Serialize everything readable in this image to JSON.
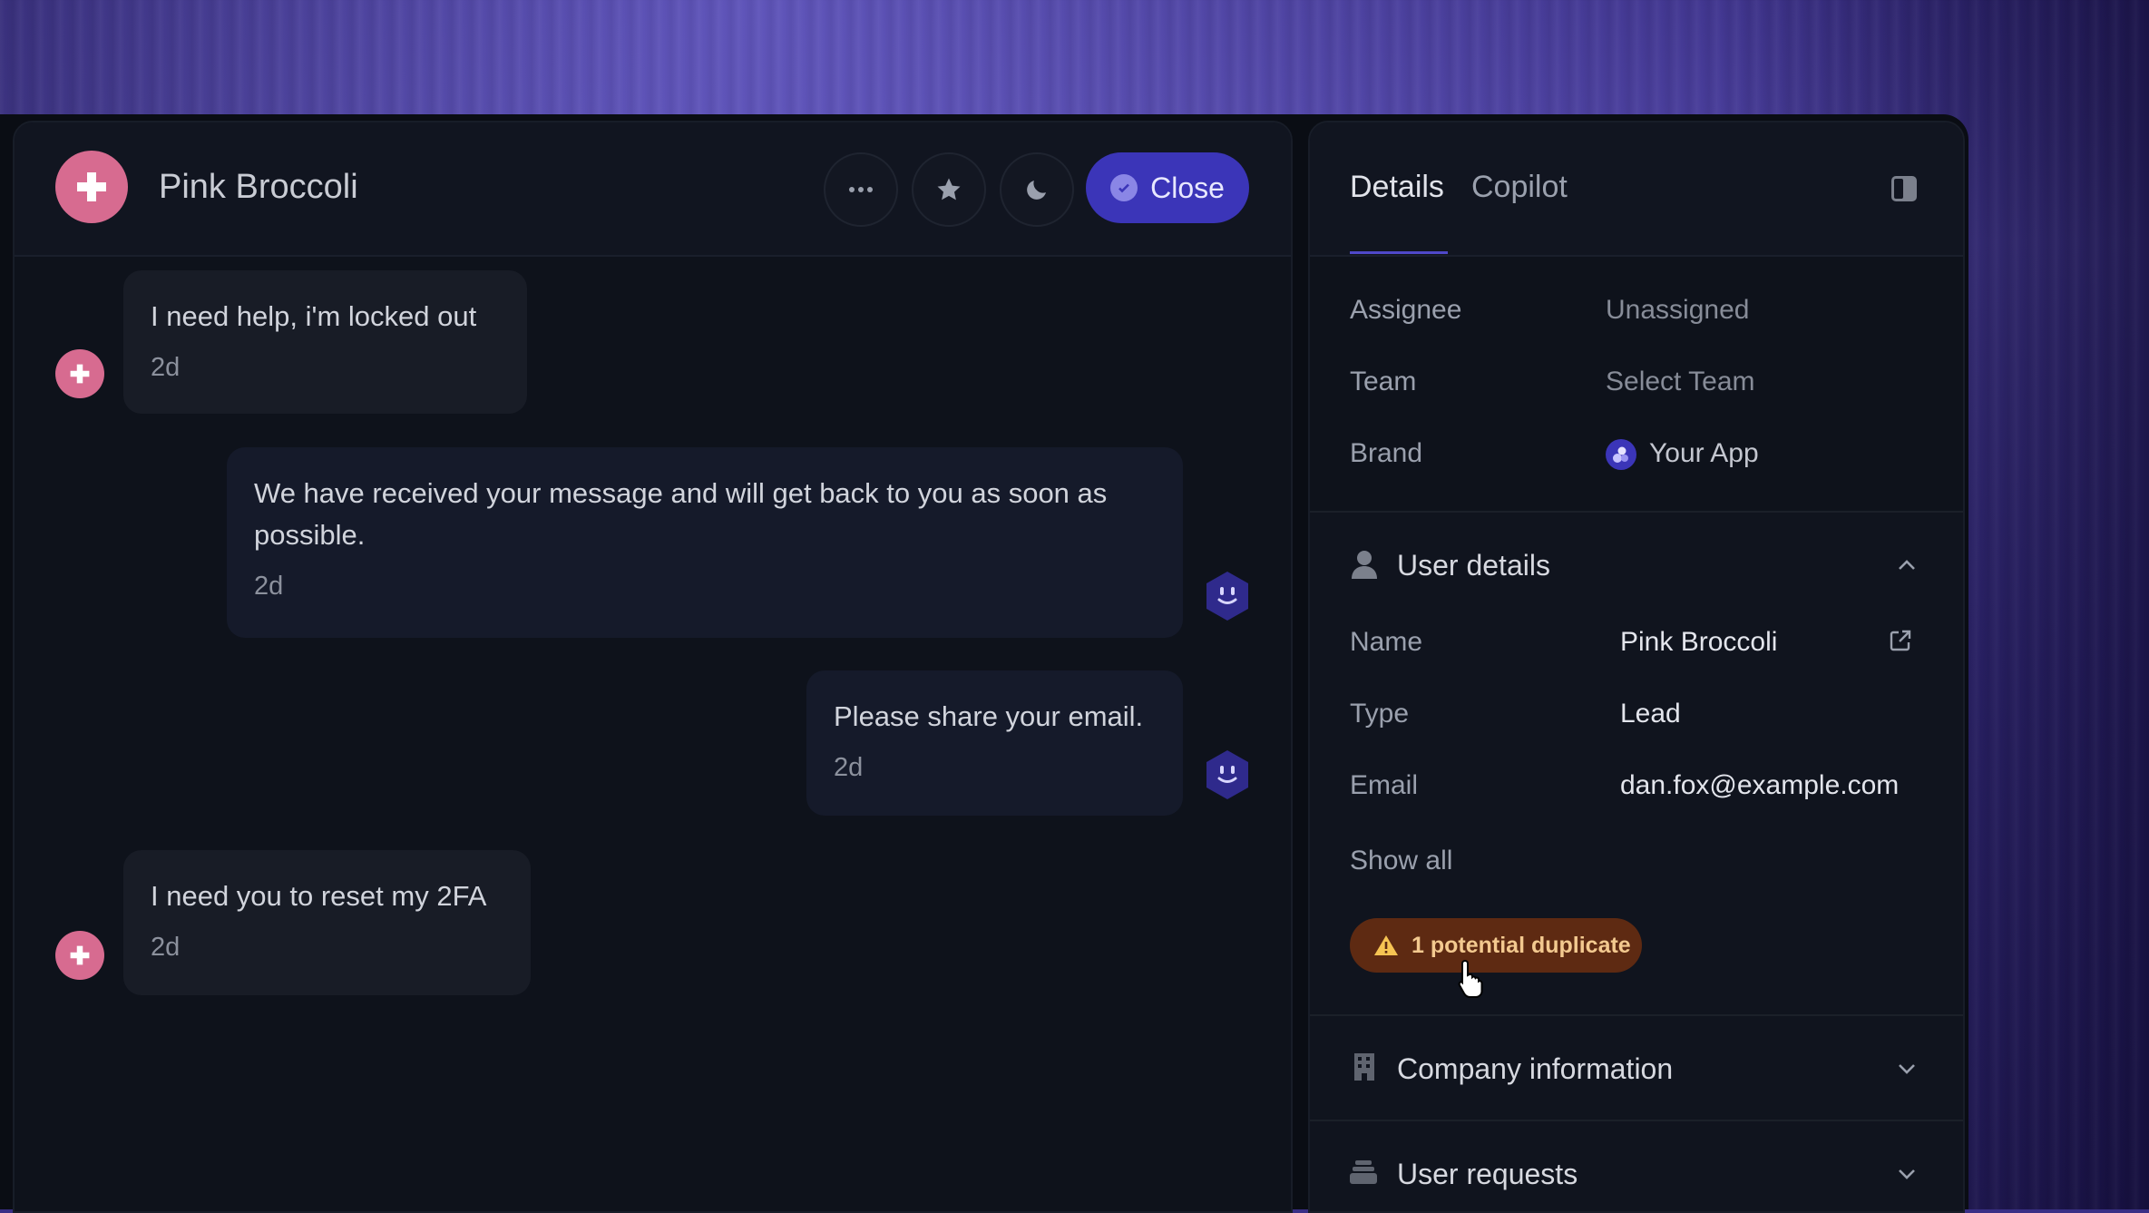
{
  "conversation": {
    "title": "Pink Broccoli",
    "header_buttons": {
      "more": "more-icon",
      "star": "star-icon",
      "snooze": "moon-icon",
      "close_label": "Close"
    },
    "messages": [
      {
        "from": "user",
        "text": "I need help, i'm locked out",
        "time": "2d"
      },
      {
        "from": "bot",
        "text": "We have received your message and will get back to you as soon as possible.",
        "time": "2d"
      },
      {
        "from": "bot",
        "text": "Please share your email.",
        "time": "2d"
      },
      {
        "from": "user",
        "text": "I need you to reset my 2FA",
        "time": "2d"
      }
    ]
  },
  "details": {
    "tabs": [
      {
        "label": "Details",
        "active": true
      },
      {
        "label": "Copilot",
        "active": false
      }
    ],
    "assignment": [
      {
        "label": "Assignee",
        "value": "Unassigned"
      },
      {
        "label": "Team",
        "value": "Select Team"
      },
      {
        "label": "Brand",
        "value": "Your App"
      }
    ],
    "user_details": {
      "title": "User details",
      "fields": [
        {
          "label": "Name",
          "value": "Pink Broccoli"
        },
        {
          "label": "Type",
          "value": "Lead"
        },
        {
          "label": "Email",
          "value": "dan.fox@example.com"
        }
      ],
      "show_all": "Show all",
      "duplicate_badge": "1 potential duplicate"
    },
    "company_information": {
      "title": "Company information"
    },
    "user_requests": {
      "title": "User requests"
    }
  },
  "colors": {
    "accent": "#3b35b8",
    "avatar_pink": "#d76b90",
    "warning_bg": "#5e2a12",
    "warning_text": "#f3c98f"
  }
}
